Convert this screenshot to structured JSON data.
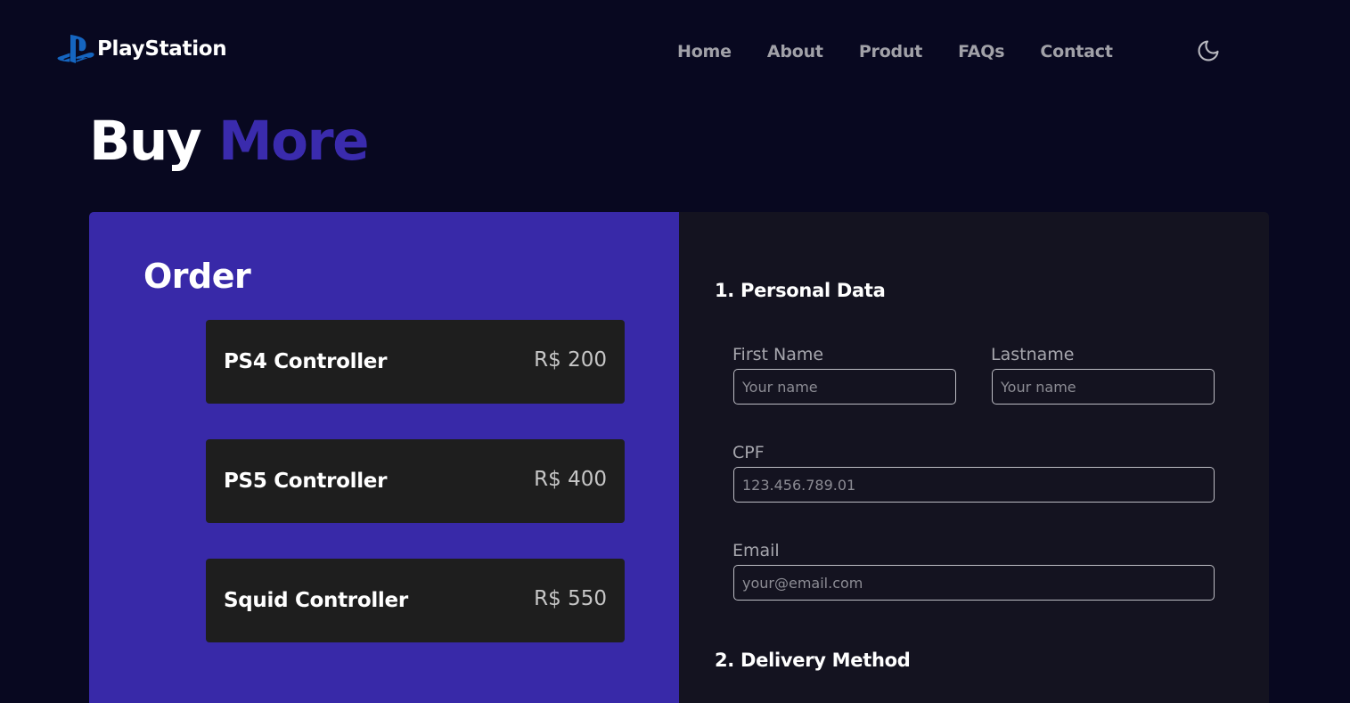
{
  "brand": {
    "name": "PlayStation",
    "icon": "playstation-logo-icon",
    "color": "#1565c0"
  },
  "nav": {
    "home": "Home",
    "about": "About",
    "produt": "Produt",
    "faqs": "FAQs",
    "contact": "Contact",
    "theme_icon": "moon-icon"
  },
  "title": {
    "part1": "Buy",
    "part2": "More"
  },
  "order": {
    "title": "Order",
    "items": [
      {
        "name": "PS4 Controller",
        "price": "R$ 200"
      },
      {
        "name": "PS5 Controller",
        "price": "R$ 400"
      },
      {
        "name": "Squid Controller",
        "price": "R$ 550"
      }
    ]
  },
  "form": {
    "section1": "1. Personal Data",
    "first_name": {
      "label": "First Name",
      "placeholder": "Your name",
      "value": ""
    },
    "last_name": {
      "label": "Lastname",
      "placeholder": "Your name",
      "value": ""
    },
    "cpf": {
      "label": "CPF",
      "placeholder": "123.456.789.01",
      "value": ""
    },
    "email": {
      "label": "Email",
      "placeholder": "your@email.com",
      "value": ""
    },
    "section2": "2. Delivery Method"
  },
  "colors": {
    "background": "#080820",
    "accent": "#3829a8",
    "card": "#1e1e1e",
    "form_panel": "#141320"
  }
}
